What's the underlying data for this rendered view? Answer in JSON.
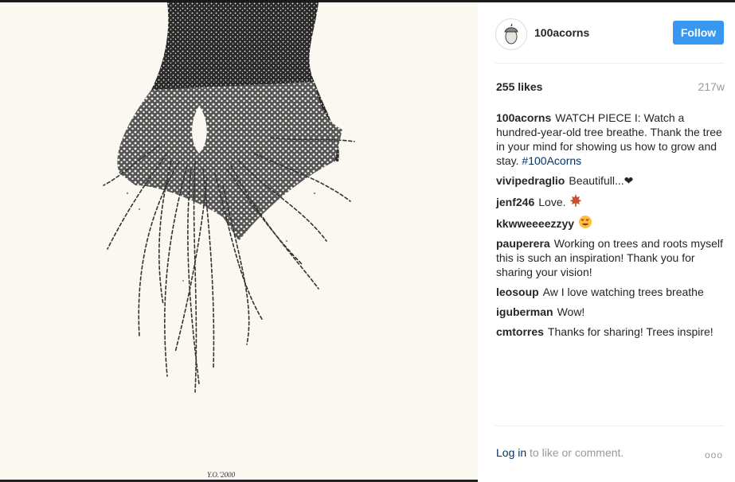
{
  "post": {
    "username": "100acorns",
    "follow_label": "Follow",
    "likes": "255 likes",
    "age": "217w",
    "caption_user": "100acorns",
    "caption_text": "WATCH PIECE I: Watch a hundred-year-old tree breathe. Thank the tree in your mind for showing us how to grow and stay.",
    "caption_hashtag": "#100Acorns",
    "signature": "Y.O.'2000"
  },
  "comments": [
    {
      "user": "vivipedraglio",
      "text": "Beautifull...❤"
    },
    {
      "user": "jenf246",
      "text": "Love. ",
      "emoji": "maple-leaf"
    },
    {
      "user": "kkwweeeezzyy",
      "text": "",
      "emoji": "heart-eyes"
    },
    {
      "user": "pauperera",
      "text": "Working on trees and roots myself this is such an inspiration! Thank you for sharing your vision!"
    },
    {
      "user": "leosoup",
      "text": "Aw I love watching trees breathe"
    },
    {
      "user": "iguberman",
      "text": "Wow!"
    },
    {
      "user": "cmtorres",
      "text": "Thanks for sharing! Trees inspire!"
    }
  ],
  "footer": {
    "login_link": "Log in",
    "login_rest": " to like or comment.",
    "more_icon": "ooo"
  },
  "colors": {
    "follow_button": "#3897f0",
    "link": "#003569",
    "muted": "#999999"
  }
}
